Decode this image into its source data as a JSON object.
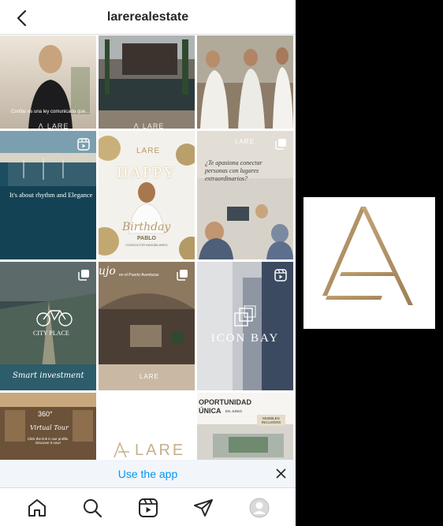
{
  "header": {
    "title": "larerealestate"
  },
  "tiles": {
    "t1": {
      "caption": "Confiar es una ley comunicada que..."
    },
    "t4": {
      "caption": "It's about rhythm and Elegance"
    },
    "t5": {
      "brand": "LARE",
      "headline": "HAPPY",
      "script": "Birthday",
      "name": "PABLO",
      "role": "CONSULTOR INMOBILIARIO"
    },
    "t6": {
      "brand": "LARE",
      "question": "¿Te apasiona conectar personas con lugares extraordinarios?"
    },
    "t7": {
      "place": "CITY PLACE",
      "tag": "Smart investment"
    },
    "t8": {
      "word": "ujo",
      "sub": "en el Puerto Aventuras",
      "brand": "LARE"
    },
    "t9": {
      "title": "ICON BAY"
    },
    "t10": {
      "badge": "360°",
      "text": "Virtual Tour",
      "cta": "Click the link in our profile. Discover it now!"
    },
    "t11": {
      "brand": "LARE"
    },
    "t12": {
      "line1": "OPORTUNIDAD",
      "line2": "ÚNICA",
      "line2sub": "EN JUNIO",
      "tag": "MUEBLES INCLUIDOS"
    }
  },
  "banner": {
    "link": "Use the app"
  },
  "tabs": [
    "home",
    "search",
    "reels",
    "direct",
    "profile"
  ],
  "colors": {
    "accent": "#0095f6",
    "gold": "#b89a6a"
  }
}
